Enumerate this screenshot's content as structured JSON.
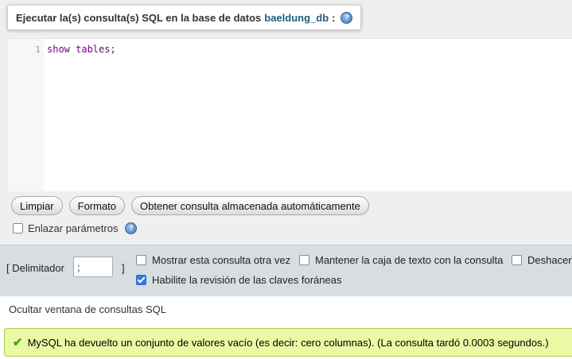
{
  "title": {
    "prefix": "Ejecutar la(s) consulta(s) SQL en la base de datos",
    "database": "baeldung_db",
    "suffix": ":"
  },
  "editor": {
    "line_number": "1",
    "code": "show tables;"
  },
  "buttons": {
    "clear": "Limpiar",
    "format": "Formato",
    "get_autosaved": "Obtener consulta almacenada automáticamente"
  },
  "bind_params": {
    "label": "Enlazar parámetros",
    "checked": false
  },
  "options": {
    "delimiter_open": "[ Delimitador",
    "delimiter_value": ";",
    "delimiter_close": "]",
    "show_query_again": {
      "label": "Mostrar esta consulta otra vez",
      "checked": false
    },
    "keep_textbox": {
      "label": "Mantener la caja de texto con la consulta",
      "checked": false
    },
    "rollback": {
      "label": "Deshacer",
      "checked": false
    },
    "foreign_keys": {
      "label": "Habilite la revisión de las claves foráneas",
      "checked": true
    }
  },
  "hide_link": "Ocultar ventana de consultas SQL",
  "message": {
    "text": "MySQL ha devuelto un conjunto de valores vacío (es decir: cero columnas). (La consulta tardó 0.0003 segundos.)",
    "status": "success"
  },
  "colors": {
    "link": "#235a81",
    "success_bg": "#ebf8a4",
    "success_border": "#a2d246",
    "options_bg": "#d8dde2"
  }
}
